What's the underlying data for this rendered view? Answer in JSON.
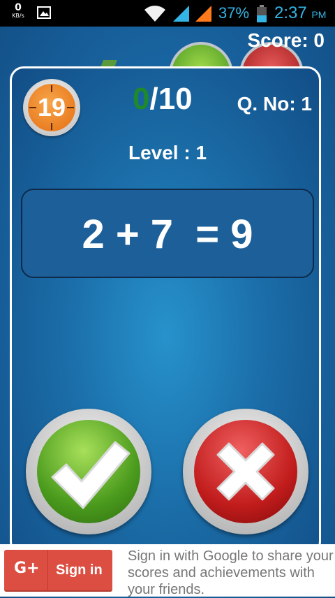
{
  "status_bar": {
    "net_speed_value": "0",
    "net_speed_unit": "KB/s",
    "battery_percent": "37%",
    "time": "2:37",
    "ampm": "PM",
    "icons": [
      "gallery-icon",
      "wifi-icon",
      "signal-icon",
      "signal-icon",
      "battery-icon"
    ]
  },
  "game": {
    "score_label": "Score: 0",
    "timer": "19",
    "correct": "0",
    "total": "/10",
    "question_number": "Q. No: 1",
    "level": "Level : 1",
    "equation": "2 + 7  = 9",
    "buttons": {
      "yes_icon": "checkmark-icon",
      "no_icon": "cross-icon"
    },
    "colors": {
      "correct_count": "#1f8a2b",
      "timer": "#e56d12",
      "yes": "#4a9a1d",
      "no": "#c11c1c"
    }
  },
  "signin": {
    "button_icon": "G+",
    "button_label": "Sign in",
    "message": "Sign in with Google to share your scores and achievements with your friends."
  }
}
